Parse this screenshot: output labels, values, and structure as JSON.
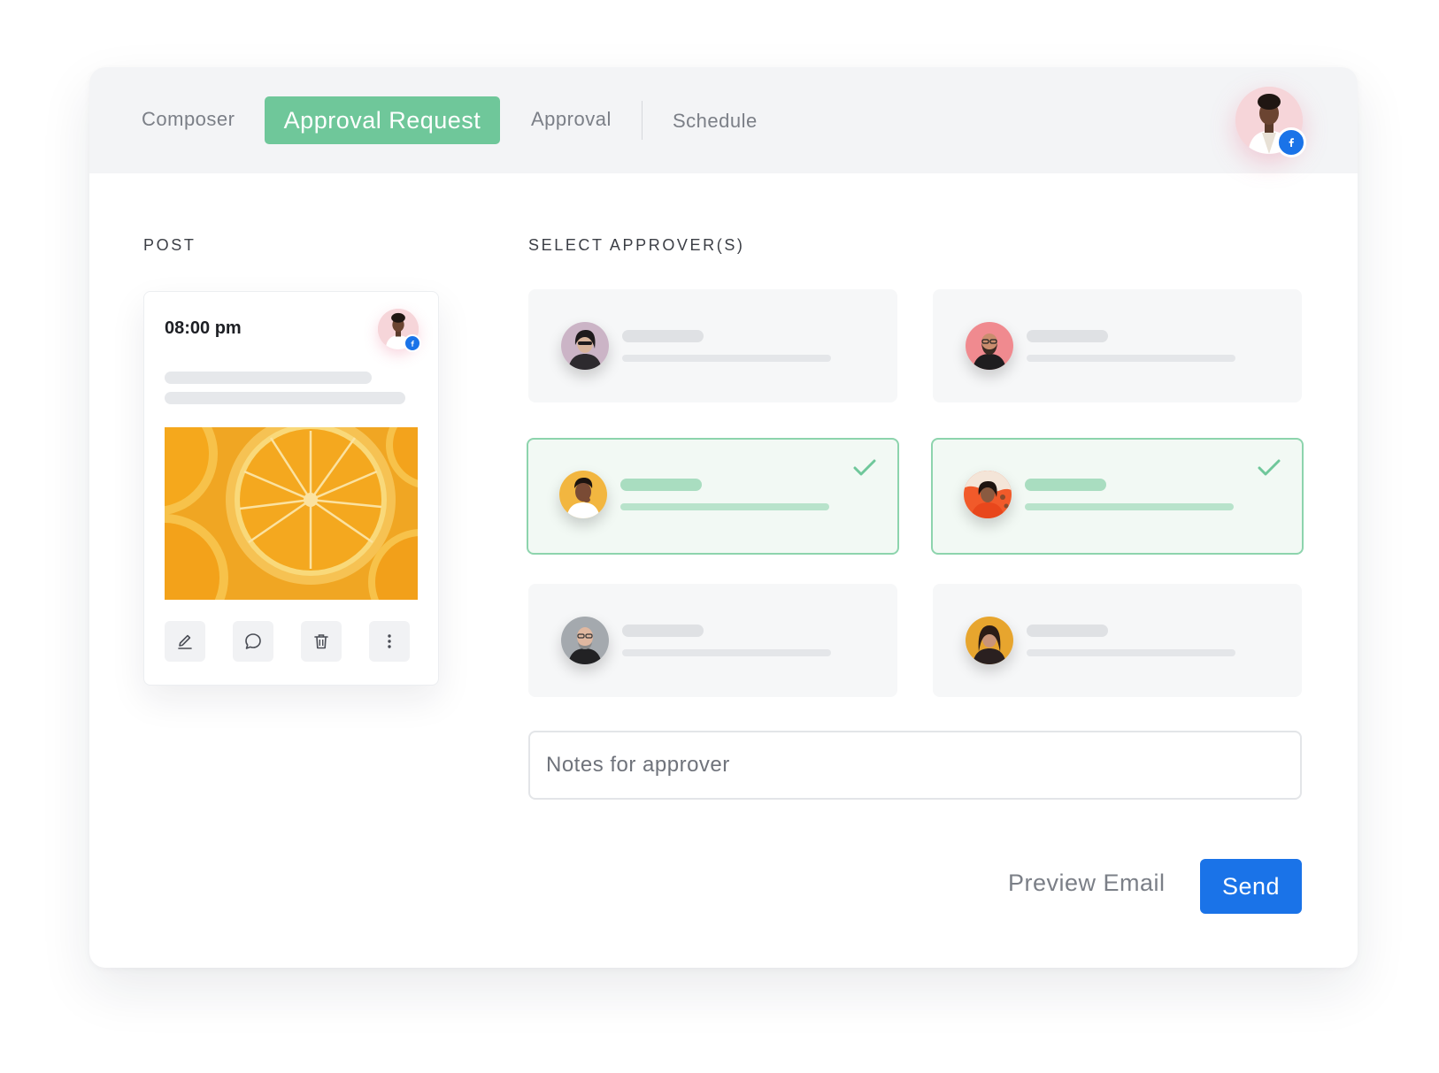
{
  "tabs": {
    "composer": "Composer",
    "approval_request": "Approval Request",
    "approval": "Approval",
    "schedule": "Schedule"
  },
  "profile": {
    "avatar_icon": "user-avatar",
    "network_icon": "facebook-icon"
  },
  "post_section": {
    "label": "POST",
    "time": "08:00 pm",
    "image_icon": "orange-slices-image",
    "actions": [
      "edit-icon",
      "comment-icon",
      "delete-icon",
      "more-icon"
    ]
  },
  "approvers_section": {
    "label": "SELECT APPROVER(S)",
    "approvers": [
      {
        "selected": false,
        "avatar_color": "#c9b2c4"
      },
      {
        "selected": false,
        "avatar_color": "#f08a8f"
      },
      {
        "selected": true,
        "avatar_color": "#f2b640"
      },
      {
        "selected": true,
        "avatar_color": "#f15a2a"
      },
      {
        "selected": false,
        "avatar_color": "#9aa0a6"
      },
      {
        "selected": false,
        "avatar_color": "#e7a52e"
      }
    ]
  },
  "notes": {
    "placeholder": "Notes for approver",
    "value": ""
  },
  "footer": {
    "preview": "Preview Email",
    "send": "Send"
  },
  "colors": {
    "accent_green": "#6fc79a",
    "primary_blue": "#1a73e8",
    "facebook_blue": "#1a73e8"
  }
}
